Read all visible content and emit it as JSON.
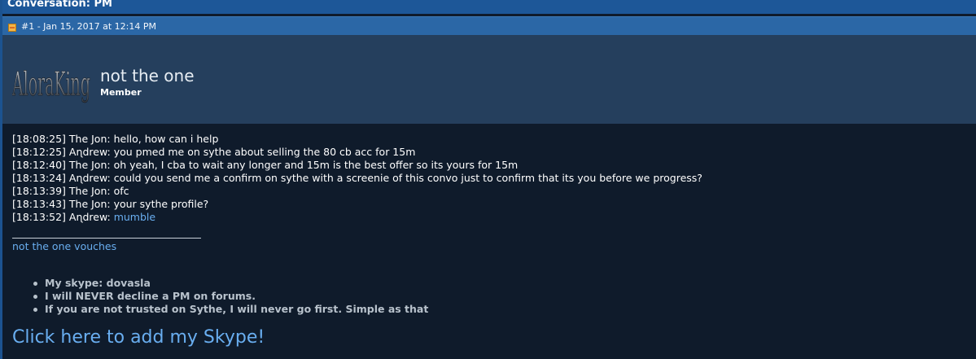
{
  "header": {
    "title": "Conversation: PM"
  },
  "post": {
    "label": "#1 - Jan 15, 2017 at 12:14 PM",
    "icon": "post-icon"
  },
  "user": {
    "avatar_text": "AloraKing",
    "name": "not the one",
    "title": "Member"
  },
  "chat": [
    {
      "time": "[18:08:25]",
      "speaker": "The Jon:",
      "text": "hello, how can i help"
    },
    {
      "time": "[18:12:25]",
      "speaker": "Aɳdrew:",
      "text": "you pmed me on sythe about selling the 80 cb acc for 15m"
    },
    {
      "time": "[18:12:40]",
      "speaker": "The Jon:",
      "text": "oh yeah, I cba to wait any longer and 15m is the best offer so its yours for 15m"
    },
    {
      "time": "[18:13:24]",
      "speaker": "Aɳdrew:",
      "text": "could you send me a confirm on sythe with a screenie of this convo just to confirm that its you before we progress?"
    },
    {
      "time": "[18:13:39]",
      "speaker": "The Jon:",
      "text": "ofc"
    },
    {
      "time": "[18:13:43]",
      "speaker": "The Jon:",
      "text": "your sythe profile?"
    },
    {
      "time": "[18:13:52]",
      "speaker": "Aɳdrew:",
      "text": "",
      "link": "mumble"
    }
  ],
  "signature": {
    "vouches_link": "not the one vouches",
    "items": [
      "My skype: dovasla",
      "I will NEVER decline a PM on forums.",
      "If you are not trusted on Sythe, I will never go first. Simple as that"
    ],
    "skype_link": "Click here to add my Skype!"
  }
}
